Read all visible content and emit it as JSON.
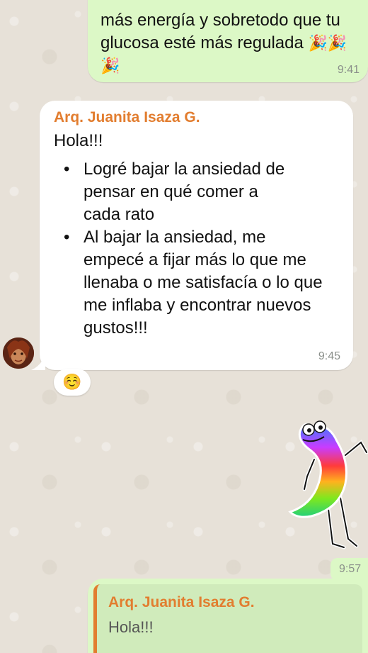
{
  "messages": {
    "top_outgoing": {
      "line1": "más energía y sobretodo que tu",
      "line2": "glucosa esté más regulada",
      "emoji": "🎉🎉",
      "emoji2": "🎉",
      "time": "9:41"
    },
    "incoming_main": {
      "sender": "Arq. Juanita Isaza G.",
      "greeting": "Hola!!!",
      "bullets": [
        "Logré bajar la ansiedad de pensar en qué comer a cada rato",
        "Al bajar la ansiedad, me empecé a fijar más lo que me llenaba o me satisfacía o lo que me inflaba y encontrar nuevos gustos!!!"
      ],
      "time": "9:45",
      "reaction": "☺️"
    },
    "sticker": {
      "time": "9:57"
    },
    "reply_outgoing": {
      "quoted_sender": "Arq. Juanita Isaza G.",
      "quoted_text": "Hola!!!"
    }
  },
  "colors": {
    "outgoing_bubble": "#dcf8c6",
    "incoming_bubble": "#ffffff",
    "sender_name": "#e27d2f",
    "wallpaper": "#e7e1d8"
  }
}
